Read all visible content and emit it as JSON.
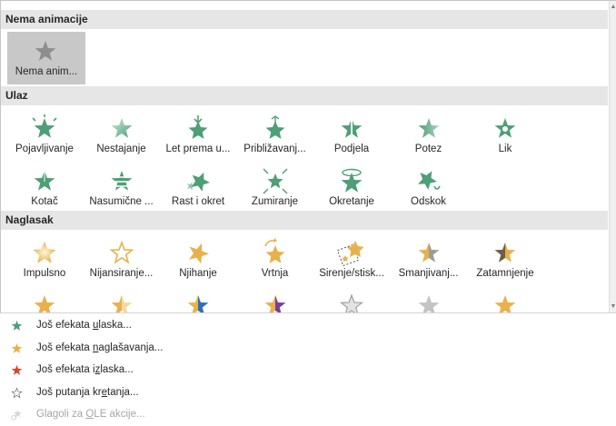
{
  "colors": {
    "entrance": "#4e9e78",
    "emphasis": "#e8b14d",
    "exit": "#d9492f",
    "path": "#8a8a8a",
    "selected_bg": "#c8c8c8",
    "section_bg": "#e6e6e6"
  },
  "sections": [
    {
      "title": "Nema animacije",
      "items": [
        {
          "label": "Nema anim...",
          "icon": "star-none-icon",
          "selected": true
        }
      ]
    },
    {
      "title": "Ulaz",
      "items": [
        {
          "label": "Pojavljivanje",
          "icon": "star-appear-icon"
        },
        {
          "label": "Nestajanje",
          "icon": "star-fade-icon"
        },
        {
          "label": "Let prema u...",
          "icon": "star-fly-in-icon"
        },
        {
          "label": "Približavanj...",
          "icon": "star-float-in-icon"
        },
        {
          "label": "Podjela",
          "icon": "star-split-icon"
        },
        {
          "label": "Potez",
          "icon": "star-wipe-icon"
        },
        {
          "label": "Lik",
          "icon": "star-shape-icon"
        },
        {
          "label": "Kotač",
          "icon": "star-wheel-icon"
        },
        {
          "label": "Nasumične ...",
          "icon": "star-random-bars-icon"
        },
        {
          "label": "Rast i okret",
          "icon": "star-grow-turn-icon"
        },
        {
          "label": "Zumiranje",
          "icon": "star-zoom-icon"
        },
        {
          "label": "Okretanje",
          "icon": "star-swivel-icon"
        },
        {
          "label": "Odskok",
          "icon": "star-bounce-icon"
        }
      ]
    },
    {
      "title": "Naglasak",
      "items": [
        {
          "label": "Impulsno",
          "icon": "star-pulse-icon"
        },
        {
          "label": "Nijansiranje...",
          "icon": "star-color-pulse-icon"
        },
        {
          "label": "Njihanje",
          "icon": "star-teeter-icon"
        },
        {
          "label": "Vrtnja",
          "icon": "star-spin-icon"
        },
        {
          "label": "Širenje/stisk...",
          "icon": "star-grow-shrink-icon"
        },
        {
          "label": "Smanjivanj...",
          "icon": "star-desaturate-icon"
        },
        {
          "label": "Zatamnjenje",
          "icon": "star-darken-icon"
        },
        {
          "label": "",
          "icon": "star-lighten-icon"
        },
        {
          "label": "",
          "icon": "star-transparency-icon"
        },
        {
          "label": "",
          "icon": "star-object-color-icon"
        },
        {
          "label": "",
          "icon": "star-complementary-color-icon"
        },
        {
          "label": "",
          "icon": "star-line-color-icon"
        },
        {
          "label": "",
          "icon": "star-fill-color-icon"
        },
        {
          "label": "",
          "icon": "star-font-color-icon"
        }
      ]
    }
  ],
  "footer": [
    {
      "prefix": "Još efekata ",
      "accel": "u",
      "suffix": "laska...",
      "icon": "entrance-star-icon",
      "color": "#4e9e78",
      "enabled": true
    },
    {
      "prefix": "Još efekata ",
      "accel": "n",
      "suffix": "aglašavanja...",
      "icon": "emphasis-star-icon",
      "color": "#e8b14d",
      "enabled": true
    },
    {
      "prefix": "Još efekata i",
      "accel": "z",
      "suffix": "laska...",
      "icon": "exit-star-icon",
      "color": "#d9492f",
      "enabled": true
    },
    {
      "prefix": "Još putanja kr",
      "accel": "e",
      "suffix": "tanja...",
      "icon": "motion-path-star-icon",
      "color": "#8a8a8a",
      "enabled": true
    },
    {
      "prefix": "Glagoli za ",
      "accel": "O",
      "suffix": "LE akcije...",
      "icon": "ole-gear-icon",
      "color": "#bdbdbd",
      "enabled": false
    }
  ],
  "scroll": {
    "up": "▲",
    "down": "▼"
  }
}
